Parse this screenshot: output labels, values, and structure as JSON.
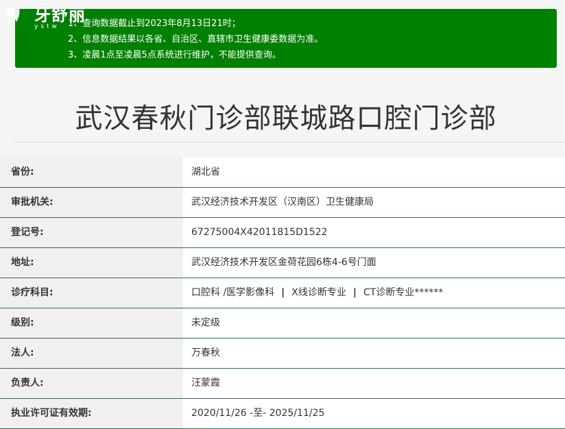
{
  "logo": {
    "brand": "牙舒丽",
    "sub": "ystw"
  },
  "notice": {
    "lines": [
      "1、查询数据截止到2023年8月13日21时；",
      "2、信息数据结果以各省、自治区、直辖市卫生健康委数据为准。",
      "3、凌晨1点至凌晨5点系统进行维护，不能提供查询。"
    ]
  },
  "page_title": "武汉春秋门诊部联城路口腔门诊部",
  "info": {
    "province": {
      "label": "省份:",
      "value": "湖北省"
    },
    "authority": {
      "label": "审批机关:",
      "value": "武汉经济技术开发区（汉南区）卫生健康局"
    },
    "reg_no": {
      "label": "登记号:",
      "value": "67275004X42011815D1522"
    },
    "address": {
      "label": "地址:",
      "value": "武汉经济技术开发区金荷花园6栋4-6号门面"
    },
    "departments": {
      "label": "诊疗科目:",
      "items": [
        "口腔科 /医学影像科",
        "X线诊断专业",
        "CT诊断专业******"
      ],
      "separator": "|"
    },
    "level": {
      "label": "级别:",
      "value": "未定级"
    },
    "legal_person": {
      "label": "法人:",
      "value": "万春秋"
    },
    "principal": {
      "label": "负责人:",
      "value": "汪蒙霞"
    },
    "validity": {
      "label": "执业许可证有效期:",
      "value": "2020/11/26 -至- 2025/11/25"
    }
  },
  "colors": {
    "notice_bg": "#008000",
    "row_border": "#2f6b4b",
    "label_bg": "#f0f0f0",
    "value_bg": "#ffffff"
  }
}
